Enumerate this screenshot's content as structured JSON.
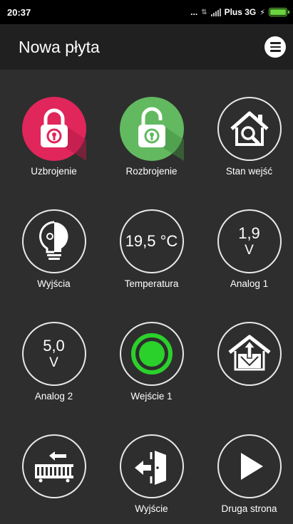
{
  "status_bar": {
    "time": "20:37",
    "dots": "...",
    "carrier": "Plus 3G",
    "battery_level": 1.0
  },
  "app_bar": {
    "title": "Nowa płyta",
    "menu_icon": "hamburger-icon"
  },
  "tiles": [
    {
      "label": "Uzbrojenie",
      "icon": "lock-closed-icon",
      "color": "#e0265b"
    },
    {
      "label": "Rozbrojenie",
      "icon": "lock-open-icon",
      "color": "#62b960"
    },
    {
      "label": "Stan wejść",
      "icon": "house-search-icon"
    },
    {
      "label": "Wyjścia",
      "icon": "bulb-icon"
    },
    {
      "label": "Temperatura",
      "value": "19,5 °C"
    },
    {
      "label": "Analog 1",
      "value": "1,9",
      "unit": "V"
    },
    {
      "label": "Analog 2",
      "value": "5,0",
      "unit": "V"
    },
    {
      "label": "Wejście 1",
      "icon": "green-dot-icon",
      "color": "#2bd12b"
    },
    {
      "label": "",
      "icon": "house-arrows-icon"
    },
    {
      "label": "",
      "icon": "gate-arrow-icon"
    },
    {
      "label": "Wyjście",
      "icon": "exit-door-icon"
    },
    {
      "label": "Druga strona",
      "icon": "play-icon"
    }
  ]
}
